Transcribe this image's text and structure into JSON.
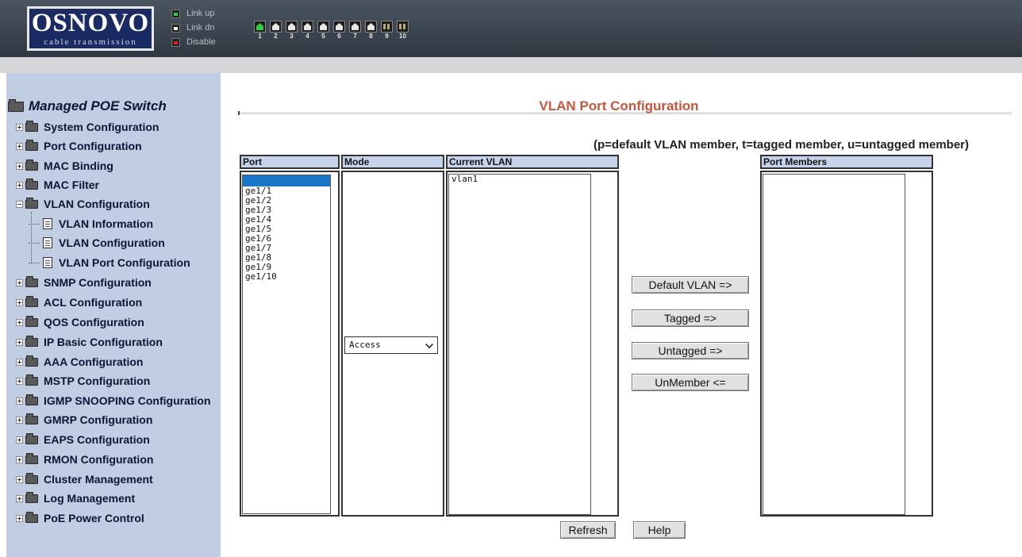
{
  "header": {
    "logo_brand": "OSNOVO",
    "logo_tagline": "cable transmission",
    "legend": [
      {
        "label": "Link up",
        "icon": "link-up-icon",
        "color": "#2ecc40"
      },
      {
        "label": "Link dn",
        "icon": "link-down-icon",
        "color": "#f0f0f0"
      },
      {
        "label": "Disable",
        "icon": "disable-icon",
        "color": "#e02020"
      }
    ],
    "ports": [
      {
        "num": "1",
        "state": "up"
      },
      {
        "num": "2",
        "state": "down"
      },
      {
        "num": "3",
        "state": "down"
      },
      {
        "num": "4",
        "state": "down"
      },
      {
        "num": "5",
        "state": "down"
      },
      {
        "num": "6",
        "state": "down"
      },
      {
        "num": "7",
        "state": "down"
      },
      {
        "num": "8",
        "state": "down"
      },
      {
        "num": "9",
        "state": "fiber"
      },
      {
        "num": "10",
        "state": "fiber"
      }
    ]
  },
  "sidebar": {
    "root": "Managed POE Switch",
    "items": [
      {
        "label": "System Configuration"
      },
      {
        "label": "Port Configuration"
      },
      {
        "label": "MAC Binding"
      },
      {
        "label": "MAC Filter"
      },
      {
        "label": "VLAN Configuration",
        "expanded": true
      },
      {
        "label": "SNMP Configuration"
      },
      {
        "label": "ACL Configuration"
      },
      {
        "label": "QOS Configuration"
      },
      {
        "label": "IP Basic Configuration"
      },
      {
        "label": "AAA Configuration"
      },
      {
        "label": "MSTP Configuration"
      },
      {
        "label": "IGMP SNOOPING Configuration"
      },
      {
        "label": "GMRP Configuration"
      },
      {
        "label": "EAPS Configuration"
      },
      {
        "label": "RMON Configuration"
      },
      {
        "label": "Cluster Management"
      },
      {
        "label": "Log Management"
      },
      {
        "label": "PoE Power Control"
      }
    ],
    "vlan_children": [
      {
        "label": "VLAN Information"
      },
      {
        "label": "VLAN Configuration"
      },
      {
        "label": "VLAN Port Configuration"
      }
    ]
  },
  "main": {
    "title": "VLAN Port Configuration",
    "note": "(p=default VLAN member, t=tagged member, u=untagged member)",
    "columns": {
      "port": "Port",
      "mode": "Mode",
      "current_vlan": "Current VLAN",
      "port_members": "Port Members"
    },
    "port_list": [
      "",
      "ge1/1",
      "ge1/2",
      "ge1/3",
      "ge1/4",
      "ge1/5",
      "ge1/6",
      "ge1/7",
      "ge1/8",
      "ge1/9",
      "ge1/10"
    ],
    "mode_value": "Access",
    "current_vlan_list": [
      "vlan1"
    ],
    "buttons": {
      "default_vlan": "Default  VLAN =>",
      "tagged": "Tagged =>",
      "untagged": "Untagged =>",
      "unmember": "UnMember <=",
      "refresh": "Refresh",
      "help": "Help"
    }
  }
}
